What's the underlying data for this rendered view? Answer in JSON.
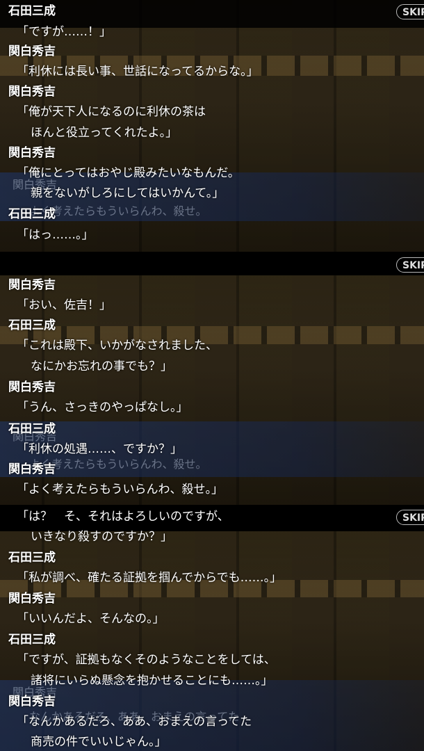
{
  "skip_label": "SKIP",
  "panel1": {
    "ghost_speaker": "関白秀吉",
    "ghost_text": "よく考えたらもういらんわ、殺せ。",
    "lines": [
      {
        "speaker": "石田三成",
        "text": [
          "「ですが……！」"
        ]
      },
      {
        "speaker": "関白秀吉",
        "text": [
          "「利休には長い事、世話になってるからな。」"
        ]
      },
      {
        "speaker": "関白秀吉",
        "text": [
          "「俺が天下人になるのに利休の茶は",
          "ほんと役立ってくれたよ。」"
        ]
      },
      {
        "speaker": "関白秀吉",
        "text": [
          "「俺にとってはおやじ殿みたいなもんだ。",
          "親をないがしろにしてはいかんて。」"
        ]
      },
      {
        "speaker": "石田三成",
        "text": [
          "「はっ……。」"
        ]
      }
    ]
  },
  "panel2": {
    "ghost_speaker": "関白秀吉",
    "ghost_text": "よく考えたらもういらんわ、殺せ。",
    "lines": [
      {
        "speaker": "関白秀吉",
        "text": [
          "「おい、佐吉！」"
        ]
      },
      {
        "speaker": "石田三成",
        "text": [
          "「これは殿下、いかがなされました、",
          "なにかお忘れの事でも？」"
        ]
      },
      {
        "speaker": "関白秀吉",
        "text": [
          "「うん、さっきのやっぱなし。」"
        ]
      },
      {
        "speaker": "石田三成",
        "text": [
          "「利休の処遇……、ですか？」"
        ]
      },
      {
        "speaker": "関白秀吉",
        "text": [
          "「よく考えたらもういらんわ、殺せ。」"
        ]
      }
    ]
  },
  "panel3": {
    "ghost_speaker": "関白秀吉",
    "ghost_text": "なんかあるだろ、ああ、おまえの言ってた",
    "lines": [
      {
        "speaker": "",
        "text": [
          "「は？　そ、それはよろしいのですが、",
          "いきなり殺すのですか？」"
        ]
      },
      {
        "speaker": "石田三成",
        "text": [
          "「私が調べ、確たる証拠を掴んでからでも……。」"
        ]
      },
      {
        "speaker": "関白秀吉",
        "text": [
          "「いいんだよ、そんなの。」"
        ]
      },
      {
        "speaker": "石田三成",
        "text": [
          "「ですが、証拠もなくそのようなことをしては、",
          "諸将にいらぬ懸念を抱かせることにも……。」"
        ]
      },
      {
        "speaker": "関白秀吉",
        "text": [
          "「なんかあるだろ、ああ、おまえの言ってた",
          "商売の件でいいじゃん。」"
        ]
      }
    ]
  }
}
